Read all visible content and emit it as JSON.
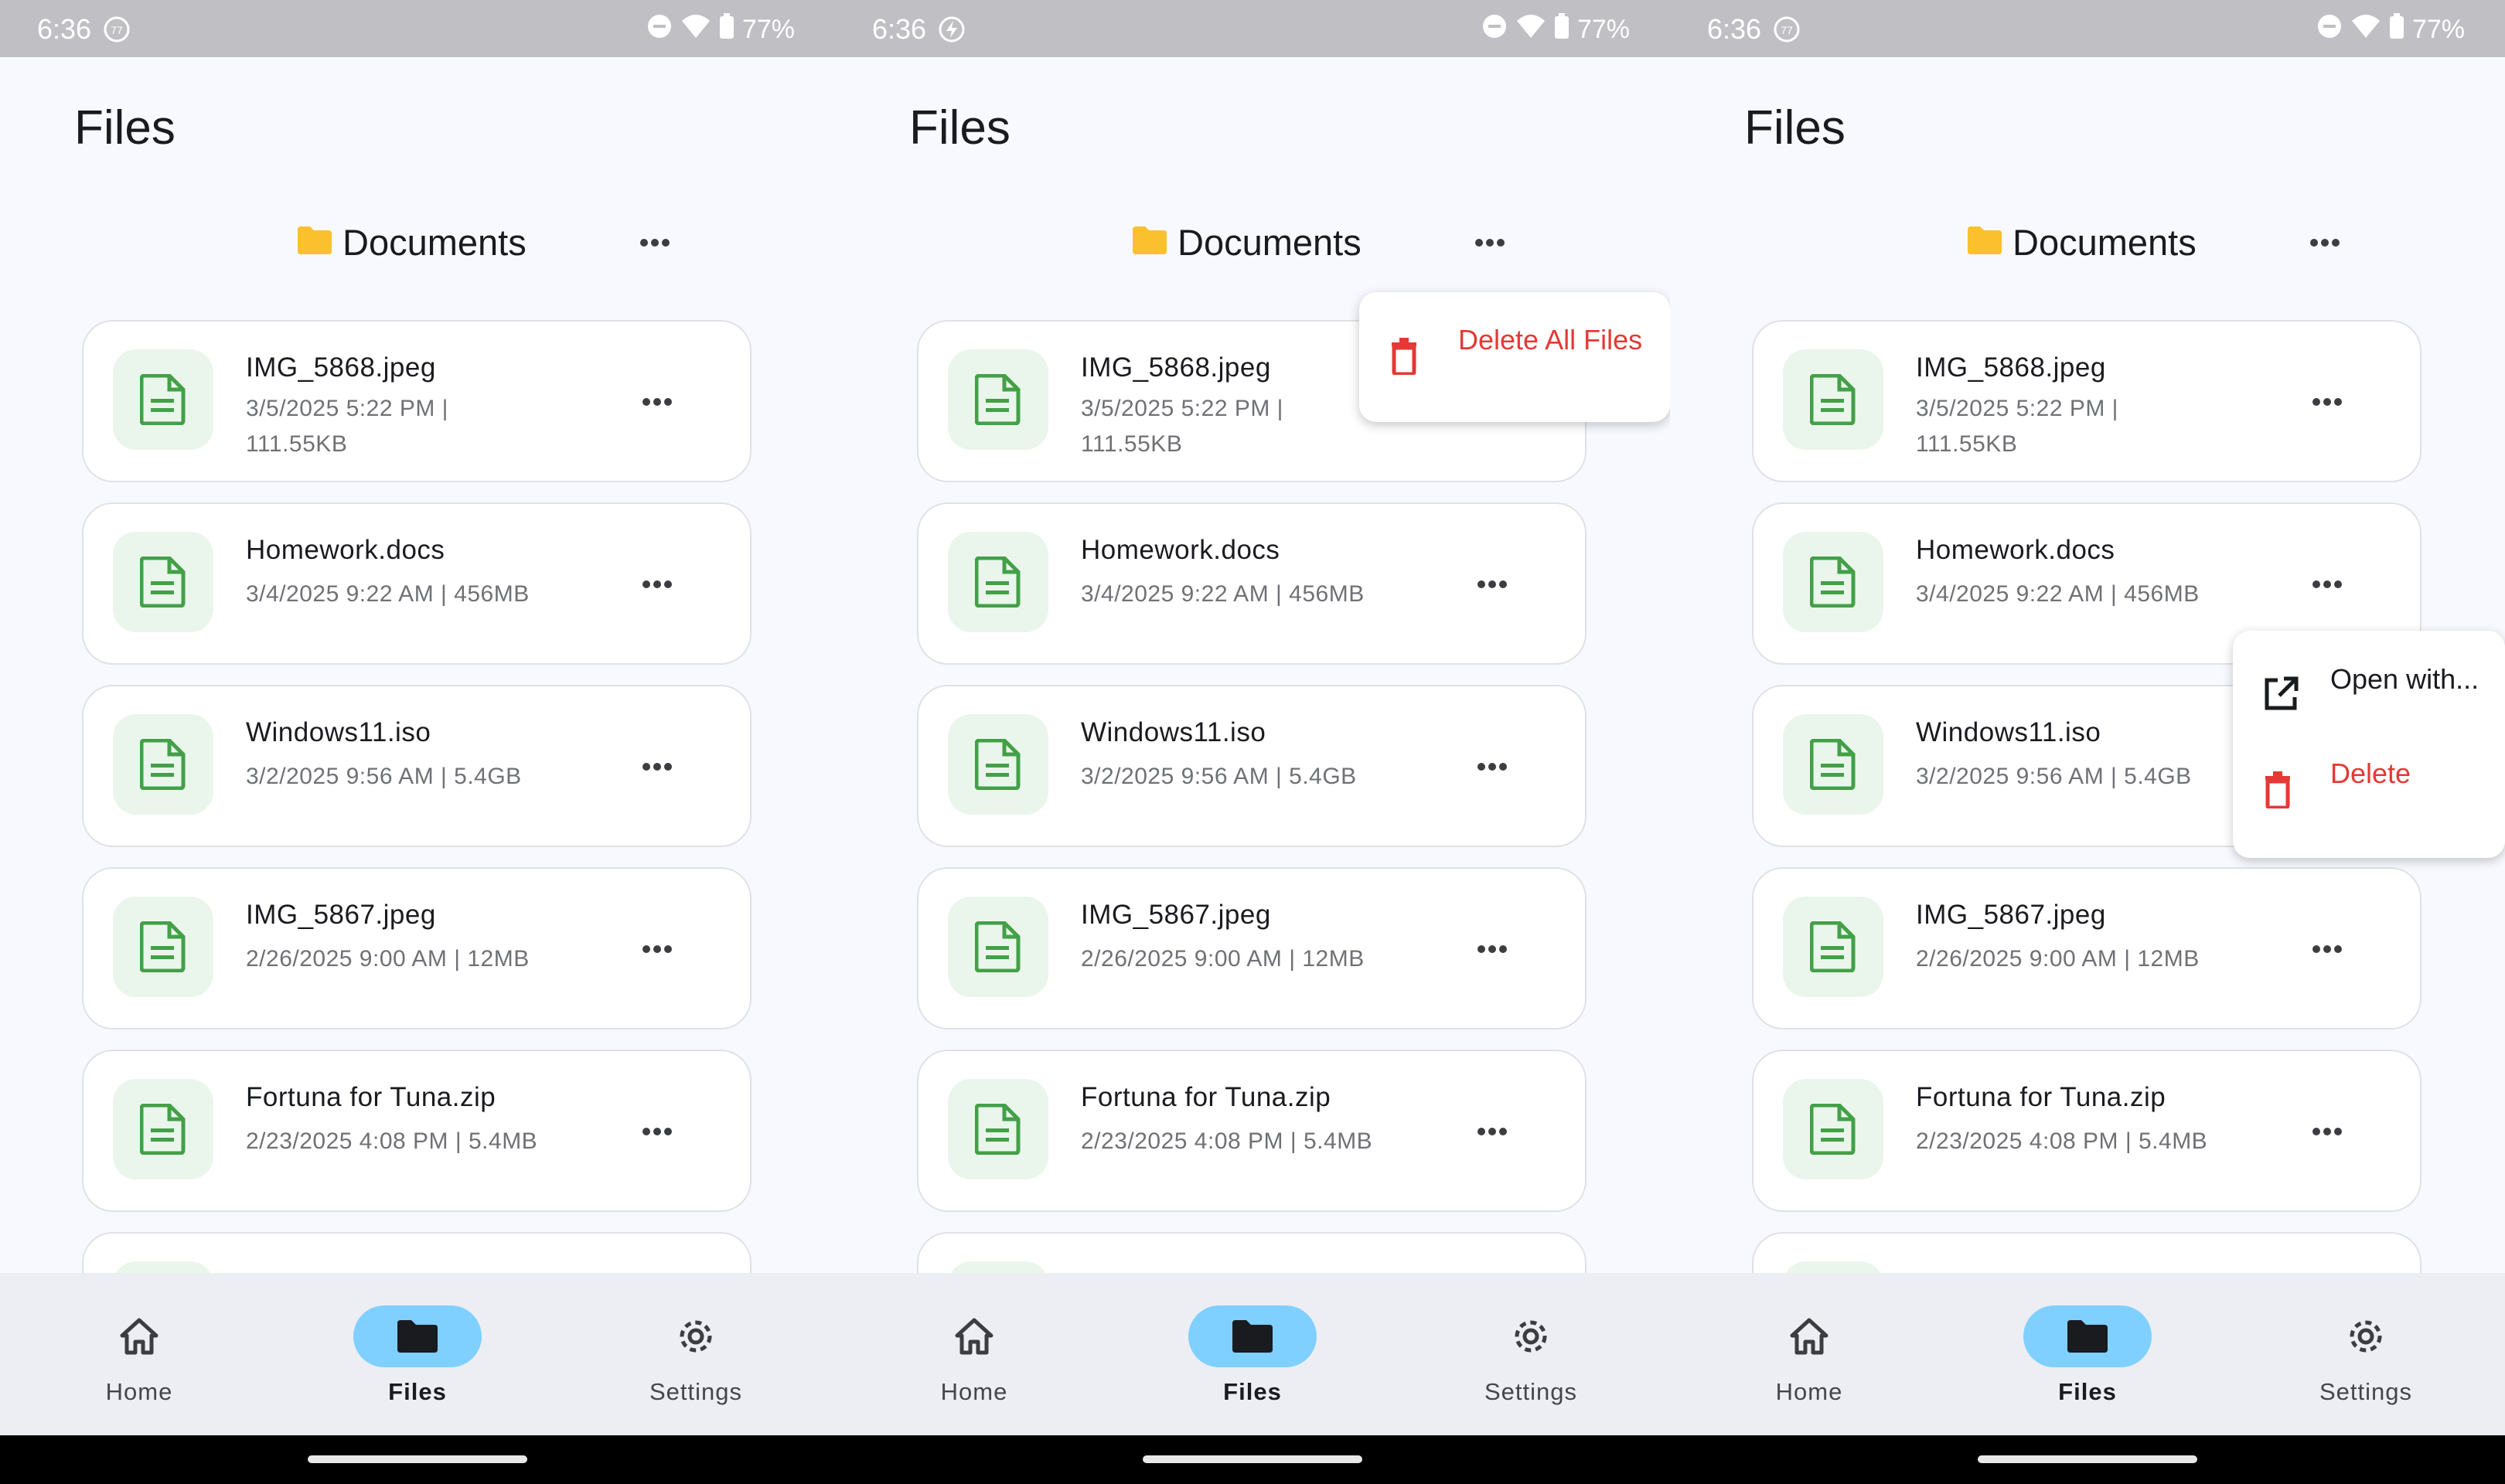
{
  "status": {
    "time": "6:36",
    "battery": "77%"
  },
  "screen_title": "Files",
  "folder": {
    "name": "Documents",
    "icon": "folder-icon",
    "color": "#fbc02d"
  },
  "files": [
    {
      "name": "IMG_5868.jpeg",
      "meta": "3/5/2025 5:22 PM | 111.55KB"
    },
    {
      "name": "Homework.docs",
      "meta": "3/4/2025 9:22 AM | 456MB"
    },
    {
      "name": "Windows11.iso",
      "meta": "3/2/2025 9:56 AM | 5.4GB"
    },
    {
      "name": "IMG_5867.jpeg",
      "meta": "2/26/2025 9:00 AM | 12MB"
    },
    {
      "name": "Fortuna for Tuna.zip",
      "meta": "2/23/2025 4:08 PM | 5.4MB"
    }
  ],
  "nav": [
    {
      "label": "Home",
      "icon": "home-icon"
    },
    {
      "label": "Files",
      "icon": "folder-icon",
      "active": true
    },
    {
      "label": "Settings",
      "icon": "gear-icon"
    }
  ],
  "folder_menu": {
    "delete_all_label": "Delete All Files"
  },
  "file_menu": {
    "open_with_label": "Open with...",
    "delete_label": "Delete"
  },
  "colors": {
    "accent": "#7fd0ff",
    "danger": "#e53935",
    "file_icon": "#43a047"
  }
}
